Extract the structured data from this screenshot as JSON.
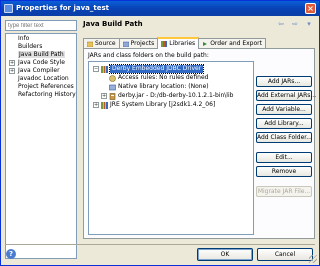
{
  "window": {
    "title": "Properties for java_test",
    "close_label": "×"
  },
  "nav": {
    "filter_placeholder": "type filter text",
    "items": [
      {
        "label": "Info",
        "expandable": false
      },
      {
        "label": "Builders",
        "expandable": false
      },
      {
        "label": "Java Build Path",
        "expandable": false,
        "selected": true
      },
      {
        "label": "Java Code Style",
        "expandable": true
      },
      {
        "label": "Java Compiler",
        "expandable": true
      },
      {
        "label": "Javadoc Location",
        "expandable": false
      },
      {
        "label": "Project References",
        "expandable": false
      },
      {
        "label": "Refactoring History",
        "expandable": false
      }
    ],
    "expander_glyph": "+"
  },
  "page": {
    "title": "Java Build Path",
    "back": "⇦",
    "forward": "⇨",
    "menu": "▾"
  },
  "tabs": [
    {
      "label": "Source",
      "icon": "source-folder-icon"
    },
    {
      "label": "Projects",
      "icon": "projects-icon"
    },
    {
      "label": "Libraries",
      "icon": "libraries-icon",
      "active": true
    },
    {
      "label": "Order and Export",
      "icon": "order-export-icon"
    }
  ],
  "libraries": {
    "panel_label": "JARs and class folders on the build path:",
    "tree": [
      {
        "label": "Derby Embedded JDBC Driver",
        "level": 0,
        "expander": "−",
        "icon": "library-icon",
        "selected": true
      },
      {
        "label": "Access rules: No rules defined",
        "level": 1,
        "icon": "access-rules-icon"
      },
      {
        "label": "Native library location: (None)",
        "level": 1,
        "icon": "native-library-icon"
      },
      {
        "label": "derby.jar - D:/db-derby-10.1.2.1-bin\\lib",
        "level": 1,
        "expander": "+",
        "icon": "jar-icon"
      },
      {
        "label": "JRE System Library [j2sdk1.4.2_06]",
        "level": 0,
        "expander": "+",
        "icon": "library-icon"
      }
    ]
  },
  "buttons": {
    "add_jars": "Add JARs...",
    "add_external_jars": "Add External JARs...",
    "add_variable": "Add Variable...",
    "add_library": "Add Library...",
    "add_class_folder": "Add Class Folder...",
    "edit": "Edit...",
    "remove": "Remove",
    "migrate_jar": "Migrate JAR File..."
  },
  "footer": {
    "help": "?",
    "ok": "OK",
    "cancel": "Cancel"
  },
  "colors": {
    "title_bar": "#0842b5",
    "selection": "#316ac5",
    "tab_highlight": "#ffc83c",
    "dialog_bg": "#ece9d8"
  }
}
